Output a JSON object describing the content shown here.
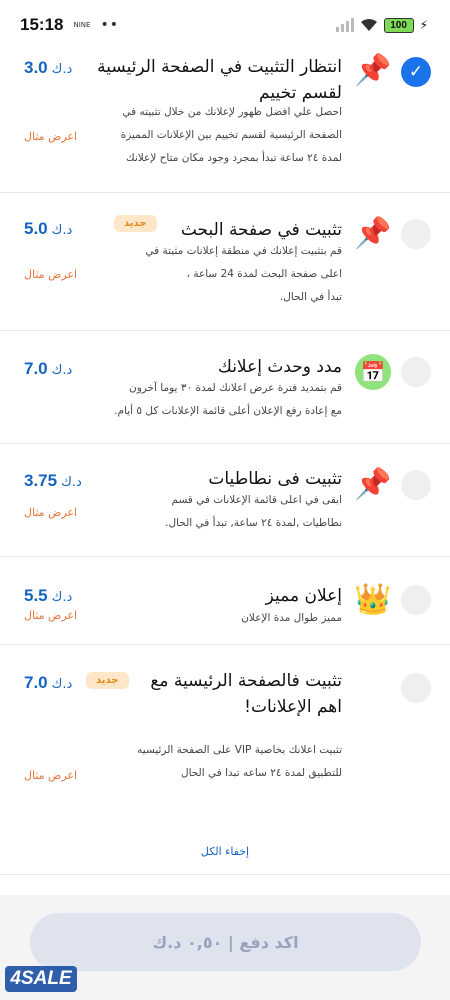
{
  "status_bar": {
    "time": "15:18",
    "small_text": "NINE",
    "dots": "••",
    "battery": "100"
  },
  "options": [
    {
      "title_line1": "انتظار التثبيت في الصفحة الرئيسية",
      "title_line2": "لقسم تخييم",
      "badge": "",
      "desc_lines": [
        "احصل علي افضل ظهور لإعلانك من خلال تثبيته في",
        "الصفحة الرئيسية لقسم تخييم بين الإعلانات المميزة",
        "لمدة ٢٤ ساعة تبدأ بمجرد وجود مكان متاح لإعلانك"
      ],
      "price": "3.0",
      "currency": "د.ك",
      "example": "اعرض مثال",
      "icon": "pushpin-icon",
      "checked": true
    },
    {
      "title_line1": "تثبيت في صفحة البحث",
      "title_line2": "",
      "badge": "جديد",
      "desc_lines": [
        "قم بتثبيت إعلانك في منطقة إعلانات مثبتة في",
        "اعلى صفحة البحث لمدة 24 ساعة ،",
        "تبدأ في الحال."
      ],
      "price": "5.0",
      "currency": "د.ك",
      "example": "اعرض مثال",
      "icon": "pushpin-icon",
      "checked": false
    },
    {
      "title_line1": "مدد وحدث إعلانك",
      "title_line2": "",
      "badge": "",
      "desc_lines": [
        "قم بتمديد فترة عرض اعلانك لمدة ٣٠ يوما آخرون",
        "مع إعادة رفع الإعلان أعلى قائمة الإعلانات كل ٥ أيام."
      ],
      "price": "7.0",
      "currency": "د.ك",
      "example": "",
      "icon": "calendar-icon",
      "checked": false
    },
    {
      "title_line1": "تثبيت فى نطاطيات",
      "title_line2": "",
      "badge": "",
      "desc_lines": [
        "ابقى في اعلى قائمة الإعلانات في قسم",
        "نطاطيات ,لمدة ٢٤ ساعة, تبدأ في الحال."
      ],
      "price": "3.75",
      "currency": "د.ك",
      "example": "اعرض مثال",
      "icon": "pushpin-icon",
      "checked": false
    },
    {
      "title_line1": "إعلان مميز",
      "title_line2": "",
      "badge": "",
      "desc_lines": [
        "مميز طوال مدة الإعلان"
      ],
      "price": "5.5",
      "currency": "د.ك",
      "example": "اعرض مثال",
      "icon": "crown-icon",
      "checked": false
    },
    {
      "title_line1": "تثبيت فالصفحة الرئيسية مع",
      "title_line2": "اهم الإعلانات!",
      "badge": "جديد",
      "desc_lines": [
        "تثبيت اعلانك بخاصية VIP على الصفحة الرئيسيه",
        "للتطبيق لمدة ٢٤ ساعه تبدا في الحال"
      ],
      "price": "7.0",
      "currency": "د.ك",
      "example": "اعرض مثال",
      "icon": "pushpin-icon",
      "checked": false
    }
  ],
  "hide_all": "إخفاء الكل",
  "pay_button": "اكد دفع | ٠,٥٠ د.ك",
  "logo": "4SALE",
  "colors": {
    "accent_blue": "#1565c0",
    "radio_checked": "#1a73e8",
    "example_orange": "#e2763a",
    "badge_bg": "#fde7c8",
    "pay_button_bg": "#dfe3ee"
  }
}
